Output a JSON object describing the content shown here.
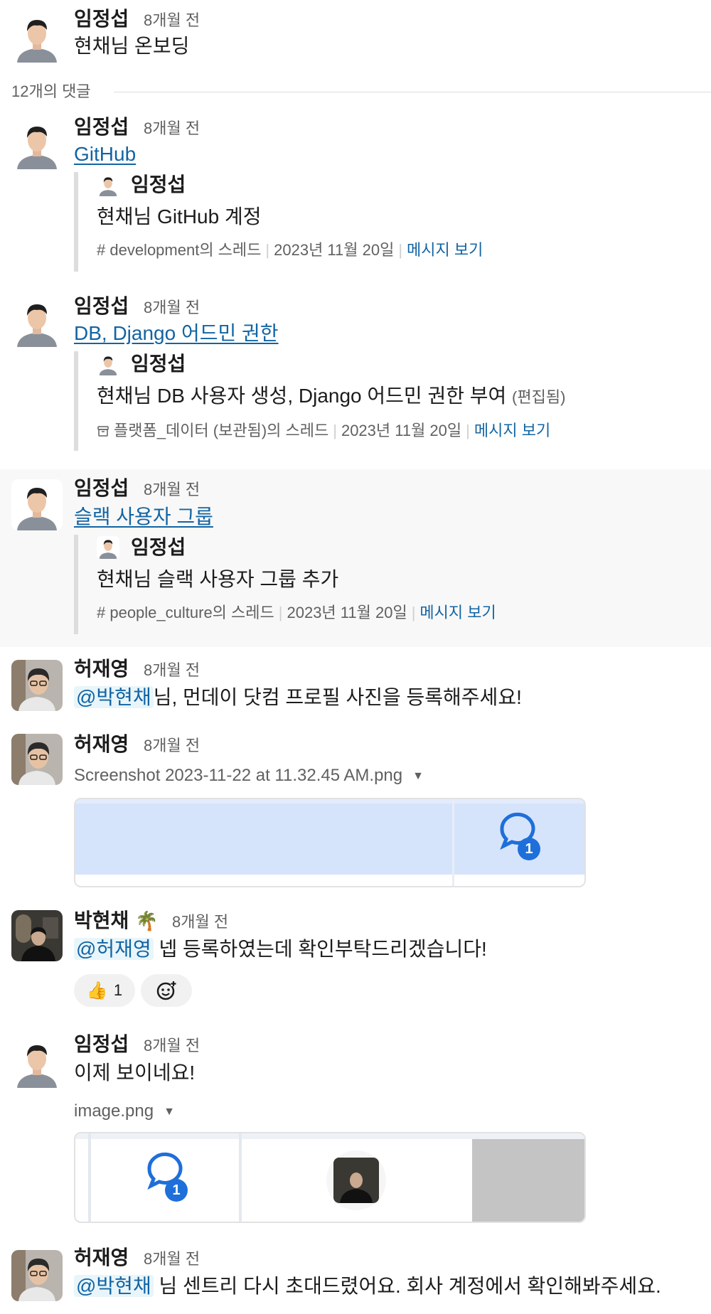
{
  "parent": {
    "author": "임정섭",
    "time": "8개월 전",
    "text": "현채님 온보딩"
  },
  "divider": {
    "label": "12개의 댓글"
  },
  "replies": [
    {
      "author": "임정섭",
      "time": "8개월 전",
      "link": "GitHub",
      "quote": {
        "author": "임정섭",
        "text": "현채님 GitHub 계정",
        "channel_icon": "hash-icon",
        "channel": "# development의 스레드",
        "date": "2023년 11월 20일",
        "view": "메시지 보기"
      }
    },
    {
      "author": "임정섭",
      "time": "8개월 전",
      "link": "DB, Django 어드민 권한",
      "quote": {
        "author": "임정섭",
        "text": "현채님 DB 사용자 생성, Django 어드민 권한 부여",
        "edited": "(편집됨)",
        "channel_icon": "archive-icon",
        "channel": "플랫폼_데이터 (보관됨)의 스레드",
        "date": "2023년 11월 20일",
        "view": "메시지 보기"
      }
    },
    {
      "author": "임정섭",
      "time": "8개월 전",
      "link": "슬랙 사용자 그룹",
      "quote": {
        "author": "임정섭",
        "text": "현채님 슬랙 사용자 그룹 추가",
        "channel_icon": "hash-icon",
        "channel": "# people_culture의 스레드",
        "date": "2023년 11월 20일",
        "view": "메시지 보기"
      }
    },
    {
      "author": "허재영",
      "time": "8개월 전",
      "mention": "@박현채",
      "text": "님, 먼데이 닷컴 프로필 사진을 등록해주세요!"
    },
    {
      "author": "허재영",
      "time": "8개월 전",
      "file": "Screenshot 2023-11-22 at 11.32.45 AM.png",
      "badge": "1"
    },
    {
      "author": "박현채",
      "status_emoji": "🌴",
      "time": "8개월 전",
      "mention": "@허재영",
      "text": "넵 등록하였는데 확인부탁드리겠습니다!",
      "reaction": {
        "emoji": "👍",
        "count": "1"
      }
    },
    {
      "author": "임정섭",
      "time": "8개월 전",
      "text": "이제 보이네요!",
      "file": "image.png",
      "badge": "1"
    },
    {
      "author": "허재영",
      "time": "8개월 전",
      "mention": "@박현채",
      "text": "님 센트리 다시 초대드렸어요. 회사 계정에서 확인해봐주세요."
    }
  ],
  "colors": {
    "link": "#1264a3",
    "mention_bg": "#e8f5fa",
    "highlight_bg": "#f8f8f8",
    "badge": "#1e6fd9"
  }
}
